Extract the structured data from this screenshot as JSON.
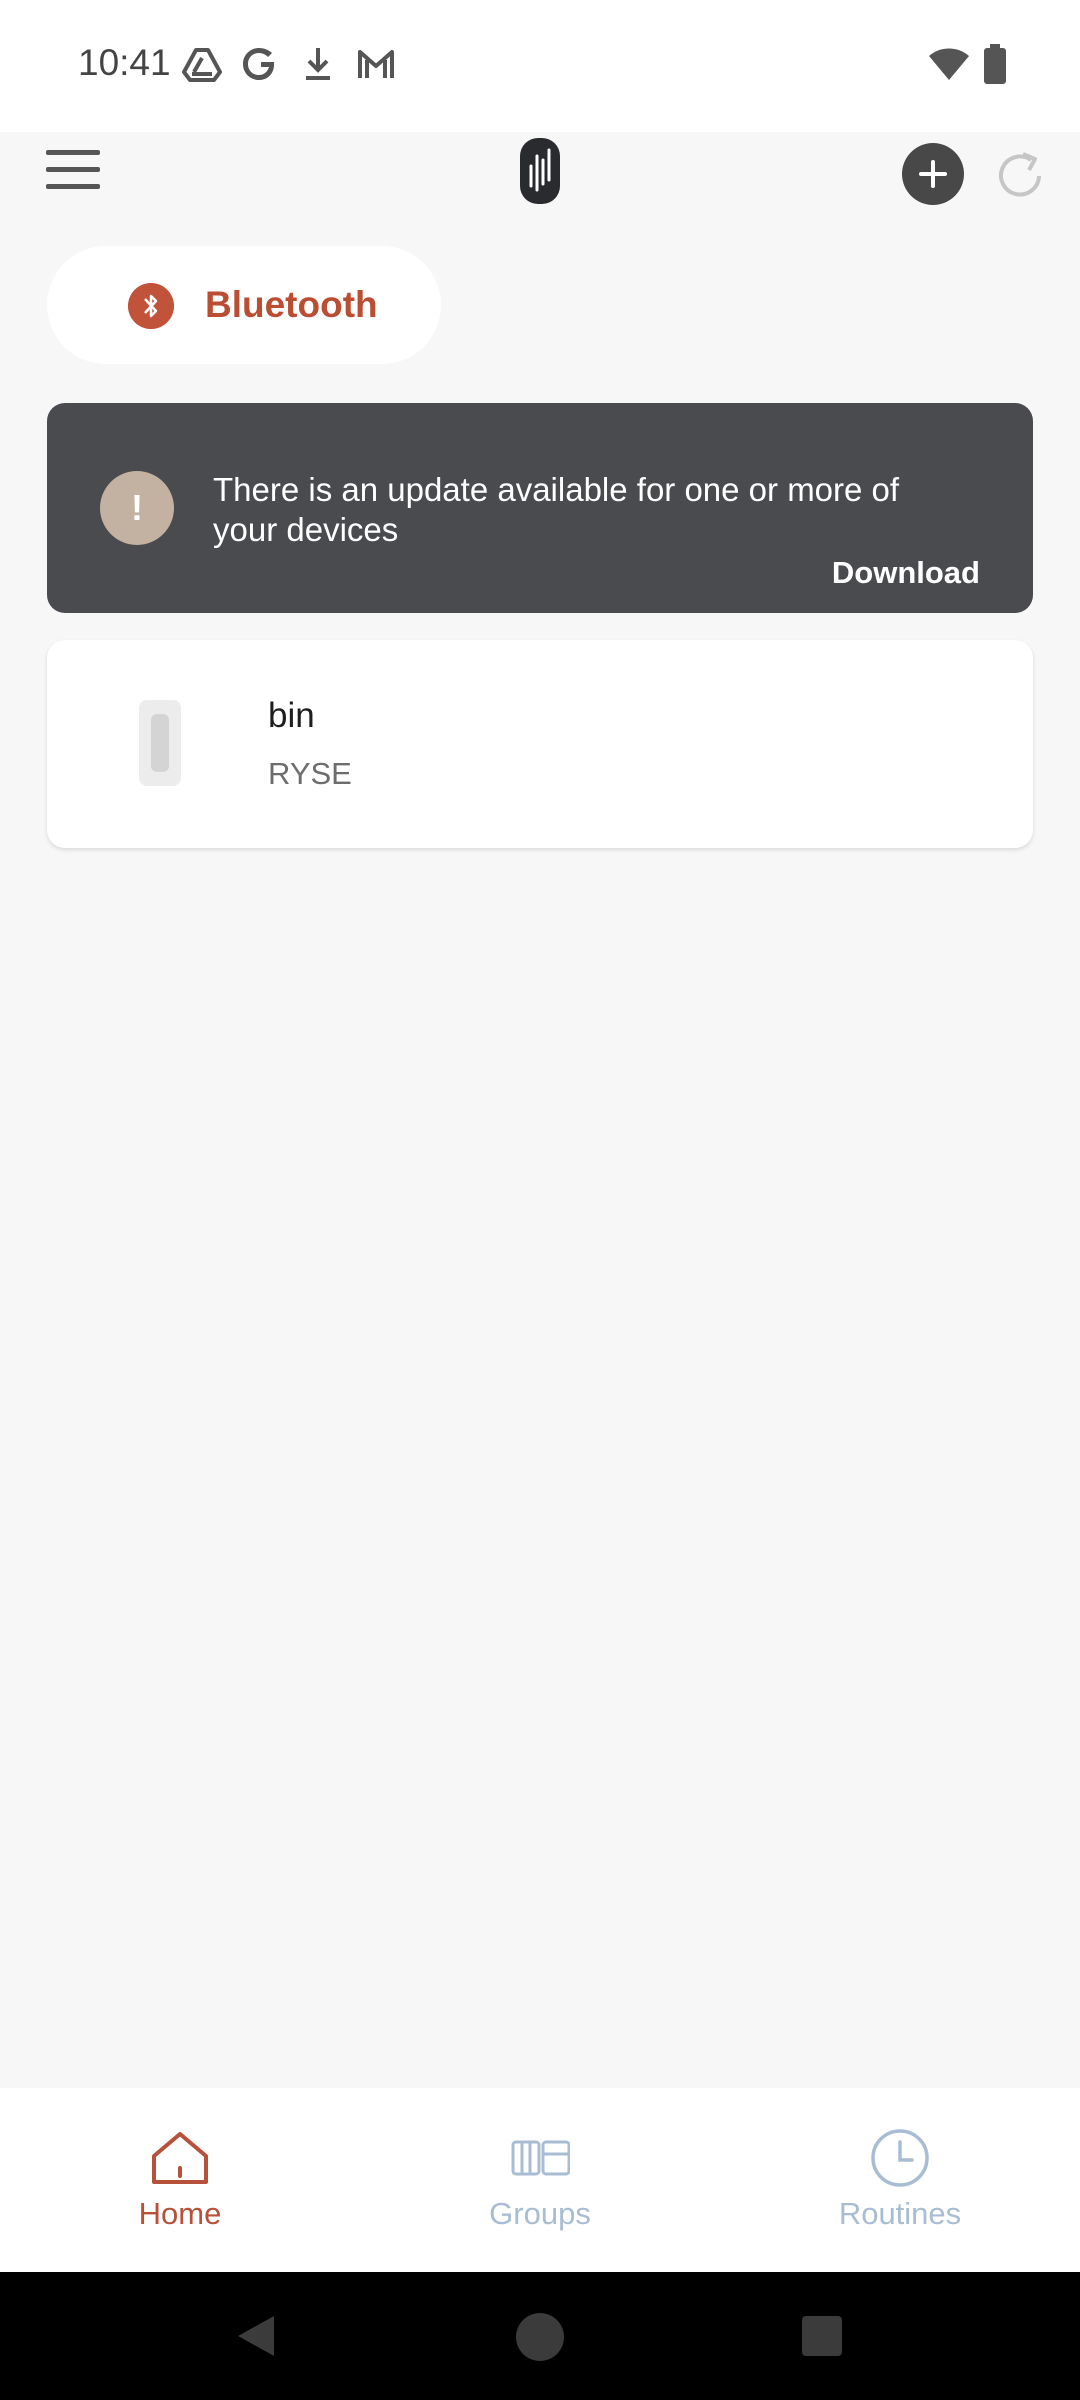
{
  "status_bar": {
    "time": "10:41",
    "left_icons": [
      "drive-icon",
      "google-icon",
      "download-icon",
      "gmail-icon"
    ],
    "right_icons": [
      "wifi-icon",
      "battery-icon"
    ]
  },
  "app_bar": {
    "menu_icon": "hamburger-menu-icon",
    "logo_icon": "ryse-logo-icon",
    "add_icon": "add-circle-icon",
    "refresh_icon": "refresh-icon"
  },
  "connection": {
    "label": "Bluetooth",
    "icon": "bluetooth-icon",
    "accent": "#bb4d33"
  },
  "update_banner": {
    "message": "There is an update available for one or more of your devices",
    "action": "Download",
    "icon": "exclamation-icon",
    "background": "#4a4b4f"
  },
  "devices": [
    {
      "name": "bin",
      "brand": "RYSE",
      "icon": "shade-device-icon"
    }
  ],
  "bottom_nav": {
    "items": [
      {
        "label": "Home",
        "icon": "home-icon",
        "active": true
      },
      {
        "label": "Groups",
        "icon": "groups-icon",
        "active": false
      },
      {
        "label": "Routines",
        "icon": "clock-icon",
        "active": false
      }
    ],
    "active_color": "#b8513a",
    "inactive_color": "#a8bdd3"
  },
  "system_nav": {
    "icons": [
      "back-icon",
      "home-circle-icon",
      "recents-icon"
    ]
  }
}
